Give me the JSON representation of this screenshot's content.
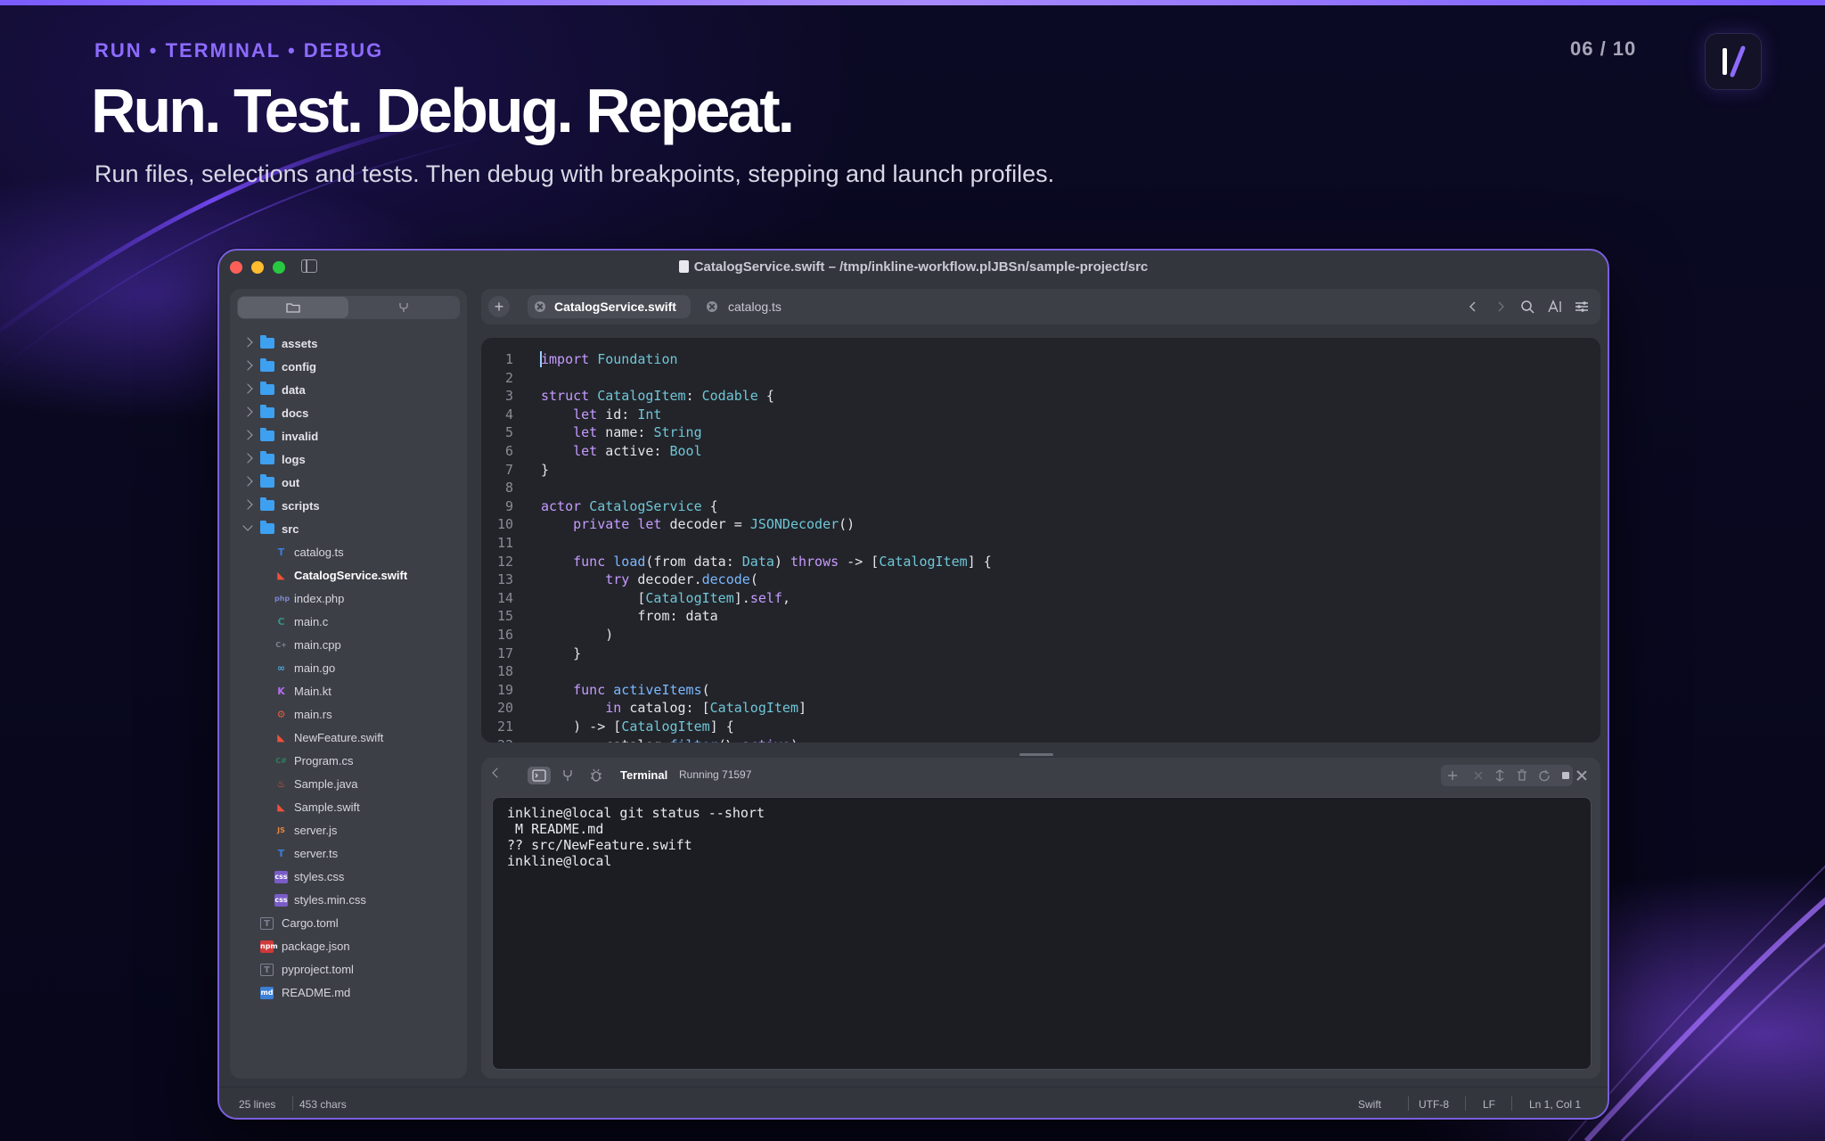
{
  "slide": {
    "eyebrow": "RUN • TERMINAL • DEBUG",
    "page_counter": "06 / 10",
    "headline": "Run. Test. Debug. Repeat.",
    "subhead": "Run files, selections and tests. Then debug with breakpoints, stepping and launch profiles."
  },
  "window": {
    "title": "CatalogService.swift – /tmp/inkline-workflow.plJBSn/sample-project/src"
  },
  "sidebar": {
    "folders": [
      {
        "label": "assets",
        "expanded": false
      },
      {
        "label": "config",
        "expanded": false
      },
      {
        "label": "data",
        "expanded": false
      },
      {
        "label": "docs",
        "expanded": false
      },
      {
        "label": "invalid",
        "expanded": false
      },
      {
        "label": "logs",
        "expanded": false
      },
      {
        "label": "out",
        "expanded": false
      },
      {
        "label": "scripts",
        "expanded": false
      },
      {
        "label": "src",
        "expanded": true
      }
    ],
    "src_files": [
      {
        "label": "catalog.ts",
        "icon": "typescript-icon",
        "glyph": "T",
        "color": "#3b7fd6"
      },
      {
        "label": "CatalogService.swift",
        "icon": "swift-icon",
        "glyph": "◣",
        "color": "#f05138",
        "selected": true
      },
      {
        "label": "index.php",
        "icon": "php-icon",
        "glyph": "php",
        "color": "#7a86c8"
      },
      {
        "label": "main.c",
        "icon": "c-icon",
        "glyph": "C",
        "color": "#3a8f86"
      },
      {
        "label": "main.cpp",
        "icon": "cpp-icon",
        "glyph": "C+",
        "color": "#7f8191"
      },
      {
        "label": "main.go",
        "icon": "go-icon",
        "glyph": "∞",
        "color": "#4aa8d8"
      },
      {
        "label": "Main.kt",
        "icon": "kotlin-icon",
        "glyph": "K",
        "color": "#b26cf0"
      },
      {
        "label": "main.rs",
        "icon": "rust-icon",
        "glyph": "⚙",
        "color": "#e05a3a"
      },
      {
        "label": "NewFeature.swift",
        "icon": "swift-icon",
        "glyph": "◣",
        "color": "#f05138"
      },
      {
        "label": "Program.cs",
        "icon": "csharp-icon",
        "glyph": "C#",
        "color": "#2f7f5a"
      },
      {
        "label": "Sample.java",
        "icon": "java-icon",
        "glyph": "♨",
        "color": "#e05a3a"
      },
      {
        "label": "Sample.swift",
        "icon": "swift-icon",
        "glyph": "◣",
        "color": "#f05138"
      },
      {
        "label": "server.js",
        "icon": "javascript-icon",
        "glyph": "JS",
        "color": "#e8843a"
      },
      {
        "label": "server.ts",
        "icon": "typescript-icon",
        "glyph": "T",
        "color": "#3b7fd6"
      },
      {
        "label": "styles.css",
        "icon": "css-icon",
        "glyph": "css",
        "color": "#7a5cc8"
      },
      {
        "label": "styles.min.css",
        "icon": "css-icon",
        "glyph": "css",
        "color": "#7a5cc8"
      }
    ],
    "root_files": [
      {
        "label": "Cargo.toml",
        "icon": "toml-icon",
        "glyph": "T",
        "color": "#7f8191"
      },
      {
        "label": "package.json",
        "icon": "npm-icon",
        "glyph": "npm",
        "color": "#d0393a"
      },
      {
        "label": "pyproject.toml",
        "icon": "toml-icon",
        "glyph": "T",
        "color": "#7f8191"
      },
      {
        "label": "README.md",
        "icon": "markdown-icon",
        "glyph": "md",
        "color": "#3b7fd6"
      }
    ]
  },
  "tabs": [
    {
      "label": "CatalogService.swift",
      "active": true
    },
    {
      "label": "catalog.ts",
      "active": false
    }
  ],
  "editor": {
    "lines": [
      [
        [
          "k",
          "import"
        ],
        [
          "",
          " "
        ],
        [
          "ty",
          "Foundation"
        ]
      ],
      [],
      [
        [
          "k",
          "struct"
        ],
        [
          "",
          " "
        ],
        [
          "ty",
          "CatalogItem"
        ],
        [
          "",
          ": "
        ],
        [
          "ty",
          "Codable"
        ],
        [
          "",
          " {"
        ]
      ],
      [
        [
          "",
          "    "
        ],
        [
          "k",
          "let"
        ],
        [
          "",
          " id: "
        ],
        [
          "ty",
          "Int"
        ]
      ],
      [
        [
          "",
          "    "
        ],
        [
          "k",
          "let"
        ],
        [
          "",
          " name: "
        ],
        [
          "ty",
          "String"
        ]
      ],
      [
        [
          "",
          "    "
        ],
        [
          "k",
          "let"
        ],
        [
          "",
          " active: "
        ],
        [
          "ty",
          "Bool"
        ]
      ],
      [
        [
          "",
          "}"
        ]
      ],
      [],
      [
        [
          "k",
          "actor"
        ],
        [
          "",
          " "
        ],
        [
          "ty",
          "CatalogService"
        ],
        [
          "",
          " {"
        ]
      ],
      [
        [
          "",
          "    "
        ],
        [
          "k",
          "private"
        ],
        [
          "",
          " "
        ],
        [
          "k",
          "let"
        ],
        [
          "",
          " decoder = "
        ],
        [
          "ty",
          "JSONDecoder"
        ],
        [
          "",
          "()"
        ]
      ],
      [],
      [
        [
          "",
          "    "
        ],
        [
          "k",
          "func"
        ],
        [
          "",
          " "
        ],
        [
          "fn",
          "load"
        ],
        [
          "",
          "(from data: "
        ],
        [
          "ty",
          "Data"
        ],
        [
          "",
          ") "
        ],
        [
          "k",
          "throws"
        ],
        [
          "",
          " -> ["
        ],
        [
          "ty",
          "CatalogItem"
        ],
        [
          "",
          "] {"
        ]
      ],
      [
        [
          "",
          "        "
        ],
        [
          "k",
          "try"
        ],
        [
          "",
          " decoder."
        ],
        [
          "fn",
          "decode"
        ],
        [
          "",
          "("
        ]
      ],
      [
        [
          "",
          "            ["
        ],
        [
          "ty",
          "CatalogItem"
        ],
        [
          "",
          "]."
        ],
        [
          "k",
          "self"
        ],
        [
          "",
          ","
        ]
      ],
      [
        [
          "",
          "            from: data"
        ]
      ],
      [
        [
          "",
          "        )"
        ]
      ],
      [
        [
          "",
          "    }"
        ]
      ],
      [],
      [
        [
          "",
          "    "
        ],
        [
          "k",
          "func"
        ],
        [
          "",
          " "
        ],
        [
          "fn",
          "activeItems"
        ],
        [
          "",
          "("
        ]
      ],
      [
        [
          "",
          "        "
        ],
        [
          "k",
          "in"
        ],
        [
          "",
          " catalog: ["
        ],
        [
          "ty",
          "CatalogItem"
        ],
        [
          "",
          "]"
        ]
      ],
      [
        [
          "",
          "    ) -> ["
        ],
        [
          "ty",
          "CatalogItem"
        ],
        [
          "",
          "] {"
        ]
      ],
      [
        [
          "",
          "        catalog."
        ],
        [
          "fn",
          "filter"
        ],
        [
          "",
          "(\\."
        ],
        [
          "k",
          "active"
        ],
        [
          "",
          ")"
        ]
      ]
    ]
  },
  "terminal": {
    "title": "Terminal",
    "status": "Running 71597",
    "output": [
      "inkline@local git status --short",
      " M README.md",
      "?? src/NewFeature.swift",
      "inkline@local"
    ]
  },
  "statusbar": {
    "lines": "25 lines",
    "chars": "453 chars",
    "language": "Swift",
    "encoding": "UTF-8",
    "line_ending": "LF",
    "cursor": "Ln 1, Col 1"
  },
  "colors": {
    "accent": "#8d6bff",
    "window_border": "#7a5fe0"
  }
}
